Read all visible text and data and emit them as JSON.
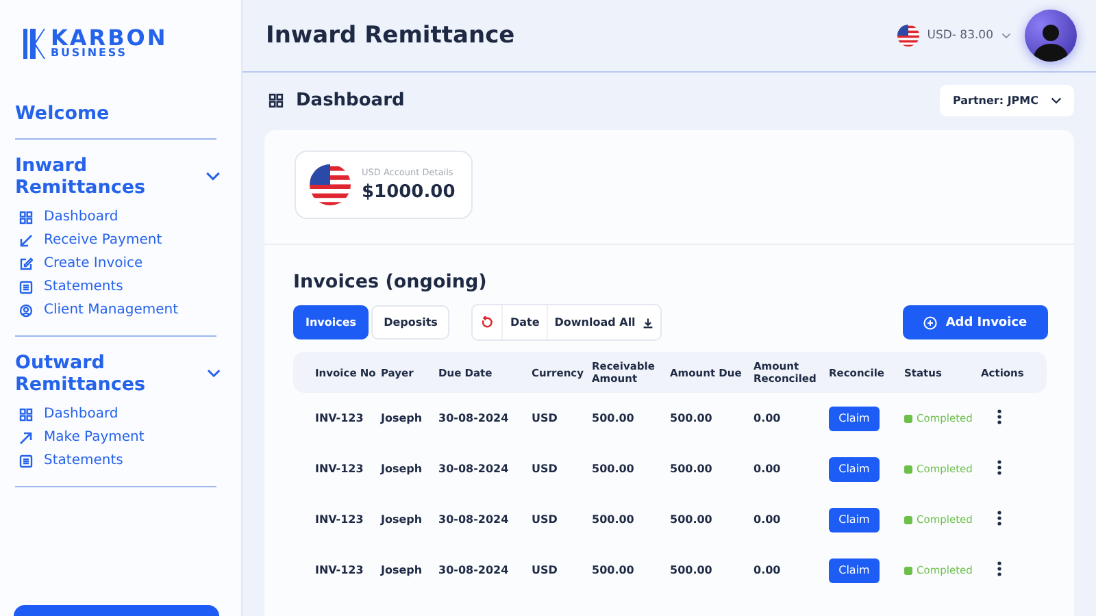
{
  "brand": {
    "name": "KARBON",
    "tagline": "BUSINESS"
  },
  "sidebar": {
    "welcome": "Welcome",
    "sections": [
      {
        "title": "Inward Remittances",
        "expanded": true,
        "items": [
          "Dashboard",
          "Receive Payment",
          "Create Invoice",
          "Statements",
          "Client Management"
        ]
      },
      {
        "title": "Outward Remittances",
        "expanded": true,
        "items": [
          "Dashboard",
          "Make Payment",
          "Statements"
        ]
      }
    ]
  },
  "header": {
    "title": "Inward Remittance",
    "rate": "USD- 83.00"
  },
  "page": {
    "title": "Dashboard",
    "partner": "Partner: JPMC"
  },
  "account": {
    "label": "USD Account Details",
    "balance": "$1000.00"
  },
  "invoices": {
    "title": "Invoices (ongoing)",
    "tabs": [
      {
        "label": "Invoices",
        "selected": true
      },
      {
        "label": "Deposits",
        "selected": false
      }
    ],
    "filters": {
      "date": "Date",
      "download": "Download All"
    },
    "add_button": "Add Invoice",
    "columns": [
      "Invoice No",
      "Payer",
      "Due Date",
      "Currency",
      "Receivable Amount",
      "Amount Due",
      "Amount Reconciled",
      "Reconcile",
      "Status",
      "Actions"
    ],
    "rows": [
      {
        "invoice": "INV-123",
        "payer": "Joseph",
        "due": "30-08-2024",
        "currency": "USD",
        "receivable": "500.00",
        "amount_due": "500.00",
        "reconciled": "0.00",
        "action": "Claim",
        "status": "Completed",
        "color": "#6cc04a"
      },
      {
        "invoice": "INV-123",
        "payer": "Joseph",
        "due": "30-08-2024",
        "currency": "USD",
        "receivable": "500.00",
        "amount_due": "500.00",
        "reconciled": "0.00",
        "action": "Claim",
        "status": "Completed",
        "color": "#6cc04a"
      },
      {
        "invoice": "INV-123",
        "payer": "Joseph",
        "due": "30-08-2024",
        "currency": "USD",
        "receivable": "500.00",
        "amount_due": "500.00",
        "reconciled": "0.00",
        "action": "Claim",
        "status": "Completed",
        "color": "#6cc04a"
      },
      {
        "invoice": "INV-123",
        "payer": "Joseph",
        "due": "30-08-2024",
        "currency": "USD",
        "receivable": "500.00",
        "amount_due": "500.00",
        "reconciled": "0.00",
        "action": "Claim",
        "status": "Completed",
        "color": "#6cc04a"
      }
    ]
  }
}
